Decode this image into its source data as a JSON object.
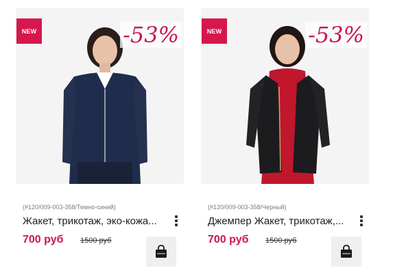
{
  "colors": {
    "accent": "#c8174a",
    "badge": "#d6174d"
  },
  "products": [
    {
      "badge": "NEW",
      "discount": "-53%",
      "sku": "(#120/009-003-358/Темно-синий)",
      "title": "Жакет, трикотаж, эко-кожа...",
      "price": "700 руб",
      "old_price": "1500 руб",
      "cart_icon": "shopping-bag-icon",
      "more_icon": "vertical-dots-icon",
      "garment_color": "#1f2d4d"
    },
    {
      "badge": "NEW",
      "discount": "-53%",
      "sku": "(#120/009-003-358/Черный)",
      "title": "Джемпер Жакет, трикотаж,...",
      "price": "700 руб",
      "old_price": "1500 руб",
      "cart_icon": "shopping-bag-icon",
      "more_icon": "vertical-dots-icon",
      "garment_color": "#1c1c1e"
    }
  ]
}
